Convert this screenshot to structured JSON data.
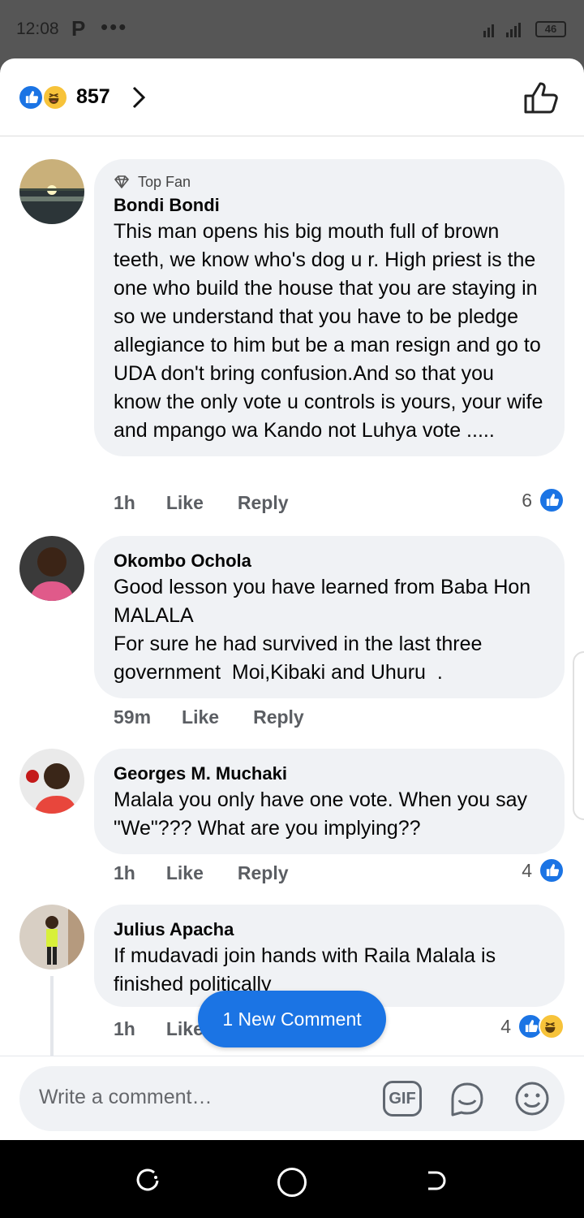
{
  "status_bar": {
    "time": "12:08",
    "app_letter": "P",
    "dots": "•••",
    "battery": "46"
  },
  "header": {
    "reaction_count": "857"
  },
  "comments": [
    {
      "badge": "Top Fan",
      "name": "Bondi Bondi",
      "text": "This man opens his big mouth full of brown teeth, we know who's dog u r. High priest is the one who build the house that you are staying in so we understand that you have to be pledge allegiance to him but be a man resign and go to UDA don't bring confusion.And so that you know the only vote u controls is yours, your wife and mpango wa Kando not Luhya vote .....",
      "time": "1h",
      "like": "Like",
      "reply": "Reply",
      "reactions": "6"
    },
    {
      "name": "Okombo Ochola",
      "text": "Good lesson you have learned from Baba Hon MALALA\nFor sure he had survived in the last three government  Moi,Kibaki and Uhuru  .",
      "time": "59m",
      "like": "Like",
      "reply": "Reply"
    },
    {
      "name": "Georges M. Muchaki",
      "text": "Malala you only have one vote. When you say \"We\"??? What are you implying??",
      "time": "1h",
      "like": "Like",
      "reply": "Reply",
      "reactions": "4"
    },
    {
      "name": "Julius Apacha",
      "text": "If mudavadi join hands with Raila Malala is finished politically",
      "time": "1h",
      "like": "Like",
      "reactions": "4"
    }
  ],
  "new_comment_pill": "1 New Comment",
  "composer": {
    "placeholder": "Write a comment…",
    "gif": "GIF"
  },
  "colors": {
    "accent": "#1b74e4",
    "bubble": "#f0f2f5",
    "haha": "#f7c33a"
  }
}
